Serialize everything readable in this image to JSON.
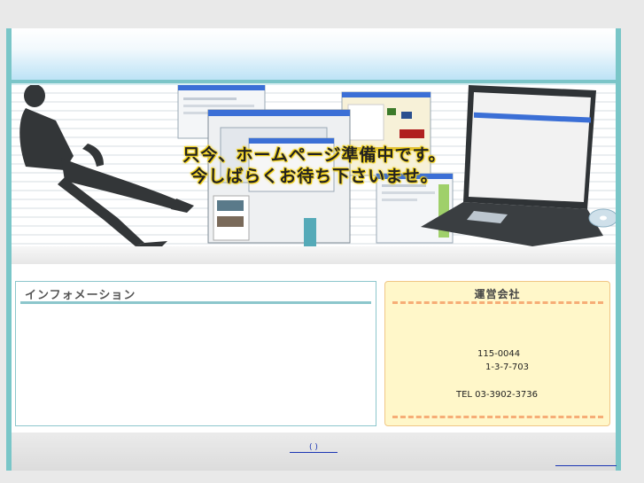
{
  "hero": {
    "line1": "只今、ホームページ準備中です。",
    "line2": "今しばらくお待ち下さいませ。"
  },
  "info": {
    "title": "インフォメーション"
  },
  "company": {
    "title": "運営会社",
    "zip": "115-0044",
    "address": "1-3-7-703",
    "tel": "TEL 03-3902-3736"
  },
  "footer": {
    "link_label": "(  )"
  },
  "colors": {
    "frame": "#79c6c8",
    "info_border": "#8cc6cc",
    "company_bg": "#fff7c9",
    "company_dash": "#f6ad76",
    "link": "#1b36b3"
  }
}
